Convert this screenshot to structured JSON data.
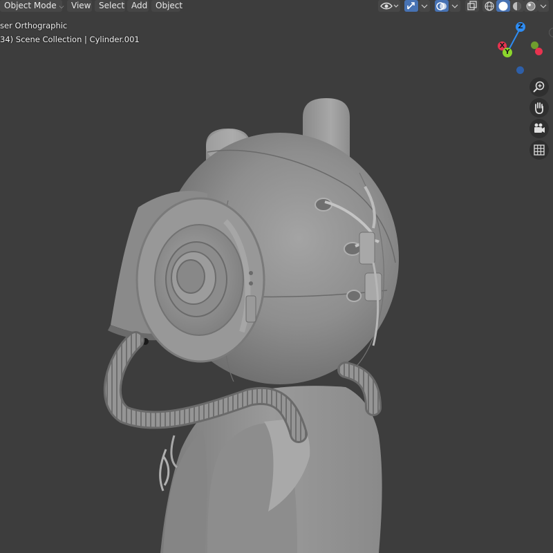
{
  "header": {
    "mode_label": "Object Mode",
    "menus": {
      "view": "View",
      "select": "Select",
      "add": "Add",
      "object": "Object"
    }
  },
  "overlay": {
    "view_name": "ser Orthographic",
    "collection_info": "34) Scene Collection | Cylinder.001"
  },
  "gizmo": {
    "z_label": "Z",
    "y_label": "Y",
    "x_label": "X"
  },
  "icons": {
    "visibility": "eye-icon",
    "gizmo_toggle": "transform-gizmo-icon",
    "overlays": "overlays-icon",
    "xray": "xray-icon",
    "wireframe_shading": "wireframe-sphere-icon",
    "solid_shading": "solid-sphere-icon",
    "material_shading": "material-sphere-icon",
    "rendered_shading": "rendered-sphere-icon",
    "zoom": "zoom-icon",
    "pan": "hand-icon",
    "camera": "camera-icon",
    "grid": "grid-icon"
  },
  "colors": {
    "viewport_bg": "#3d3d3d",
    "active_tool": "#4772b3",
    "axis_x": "#e8334f",
    "axis_y": "#8cd62c",
    "axis_z": "#2e8cf2"
  }
}
